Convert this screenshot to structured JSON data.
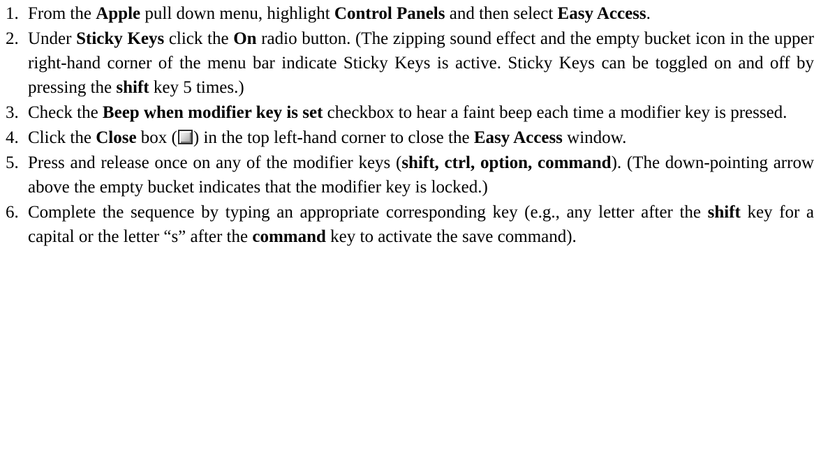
{
  "steps": [
    {
      "num": "1.",
      "parts": [
        "From the ",
        "Apple",
        " pull down menu, highlight ",
        "Control Panels",
        " and then select ",
        "Easy Access",
        "."
      ]
    },
    {
      "num": "2.",
      "parts": [
        "Under ",
        "Sticky Keys",
        " click the ",
        "On",
        " radio button. (The zipping sound effect and the empty bucket icon in the upper right-hand corner of the menu bar indicate Sticky Keys is active. Sticky Keys can be toggled on and off by pressing the ",
        "shift",
        " key 5 times.)"
      ]
    },
    {
      "num": "3.",
      "parts": [
        "Check the ",
        "Beep when modifier key is set",
        " checkbox to hear a faint beep each time a modifier key is pressed."
      ]
    },
    {
      "num": "4.",
      "parts": [
        "Click the ",
        "Close",
        " box (",
        ") in the top left-hand corner to close the ",
        "Easy Access",
        " window."
      ],
      "icon": "close-box-icon"
    },
    {
      "num": "5.",
      "parts": [
        "Press and release once on any of the modifier keys (",
        "shift, ctrl, option, command",
        "). (The down-pointing arrow above the empty bucket indicates that the modifier key is locked.)"
      ]
    },
    {
      "num": "6.",
      "parts": [
        "Complete the sequence by typing an appropriate corresponding key (e.g., any letter after the ",
        "shift",
        " key for a capital or the letter “s” after the ",
        "command",
        " key to activate the save command)."
      ]
    }
  ]
}
